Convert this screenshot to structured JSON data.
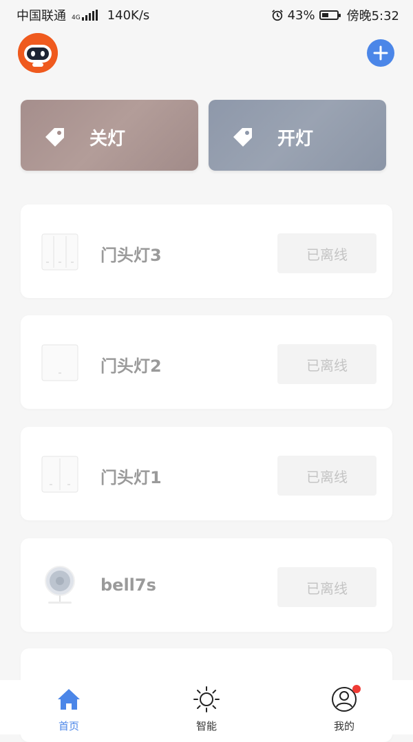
{
  "status_bar": {
    "carrier": "中国联通",
    "network": "4G",
    "speed": "140K/s",
    "battery": "43%",
    "battery_level": 0.43,
    "time": "傍晚5:32"
  },
  "scenes": [
    {
      "label": "关灯"
    },
    {
      "label": "开灯"
    }
  ],
  "devices": [
    {
      "name": "门头灯3",
      "status": "已离线",
      "icon": "triple-switch-icon"
    },
    {
      "name": "门头灯2",
      "status": "已离线",
      "icon": "single-switch-icon"
    },
    {
      "name": "门头灯1",
      "status": "已离线",
      "icon": "double-switch-icon"
    },
    {
      "name": "bell7s",
      "status": "已离线",
      "icon": "camera-doorbell-icon"
    }
  ],
  "tabs": [
    {
      "label": "首页",
      "icon": "home-icon",
      "active": true
    },
    {
      "label": "智能",
      "icon": "sun-icon",
      "active": false
    },
    {
      "label": "我的",
      "icon": "user-icon",
      "active": false
    }
  ],
  "colors": {
    "accent": "#4b86e8",
    "avatar_bg": "#ef5a1e",
    "badge": "#ef3b35",
    "scene_off": "#a58e8c",
    "scene_on": "#8e98aa"
  }
}
